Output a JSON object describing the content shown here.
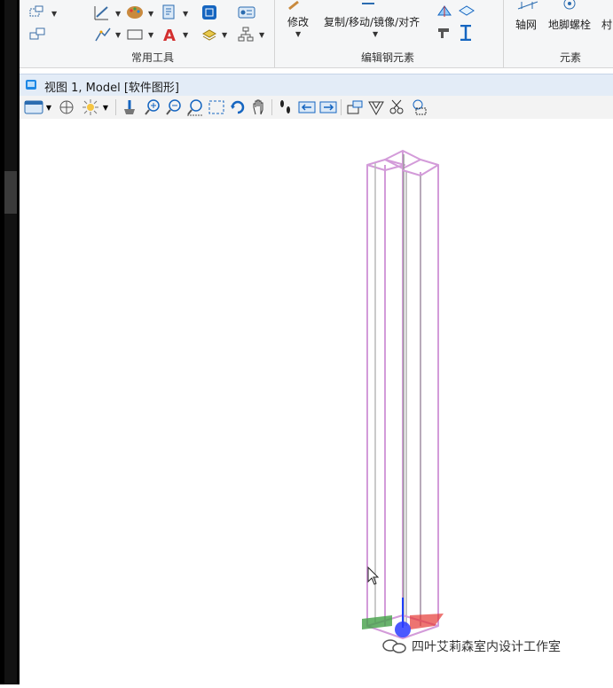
{
  "ribbon": {
    "groups": {
      "common_tools": "常用工具",
      "edit_steel": "编辑钢元素",
      "elements": "元素"
    },
    "buttons": {
      "modify": "修改",
      "copy_move": "复制/移动/镜像/对齐",
      "grid": "轴网",
      "anchor_bolt": "地脚螺栓",
      "more_cut": "村"
    }
  },
  "view": {
    "title": "视图 1, Model [软件图形]"
  },
  "watermark": {
    "text": "四叶艾莉森室内设计工作室"
  },
  "colors": {
    "column_stroke": "#d39bd9",
    "column_core": "#9a9a9a",
    "axis_x": "#e53935",
    "axis_y": "#43a047",
    "axis_z": "#1e40ff"
  }
}
